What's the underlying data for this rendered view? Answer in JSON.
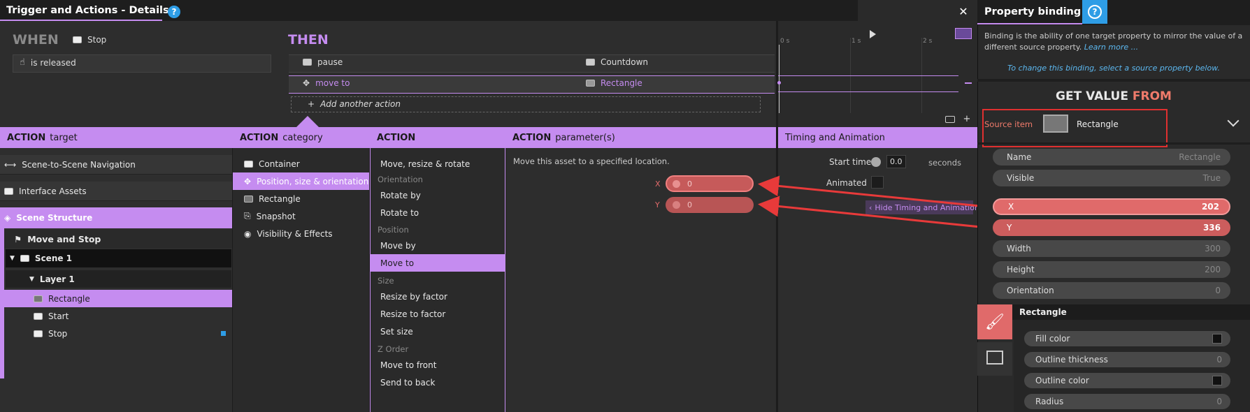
{
  "dialog": {
    "title": "Trigger and Actions - Details",
    "help_glyph": "?",
    "close_glyph": "✕"
  },
  "when": {
    "heading": "WHEN",
    "item": "Stop",
    "event": "is released"
  },
  "then": {
    "heading": "THEN",
    "actions": [
      {
        "name": "pause",
        "target": "Countdown"
      },
      {
        "name": "move to",
        "target": "Rectangle"
      }
    ],
    "add_label": "Add another action"
  },
  "timeline": {
    "ticks": [
      "0 s",
      "1 s",
      "2 s"
    ]
  },
  "headers": {
    "target_bold": "ACTION",
    "target_light": "target",
    "category_bold": "ACTION",
    "category_light": "category",
    "action_bold": "ACTION",
    "params_bold": "ACTION",
    "params_light": "parameter(s)",
    "timing": "Timing and Animation"
  },
  "targets": {
    "nav": "Scene-to-Scene Navigation",
    "assets": "Interface Assets",
    "structure": "Scene Structure",
    "move_stop": "Move and Stop",
    "scene": "Scene 1",
    "layer": "Layer 1",
    "rect": "Rectangle",
    "start": "Start",
    "stop": "Stop"
  },
  "categories": [
    "Container",
    "Position, size & orientation",
    "Rectangle",
    "Snapshot",
    "Visibility & Effects"
  ],
  "actions": {
    "top": "Move, resize & rotate",
    "g_orient": "Orientation",
    "rotate_by": "Rotate by",
    "rotate_to": "Rotate to",
    "g_pos": "Position",
    "move_by": "Move by",
    "move_to": "Move to",
    "g_size": "Size",
    "resize_by": "Resize by factor",
    "resize_to": "Resize to factor",
    "set_size": "Set size",
    "g_z": "Z Order",
    "front": "Move to front",
    "back": "Send to back"
  },
  "params": {
    "description": "Move this asset to a specified location.",
    "x_label": "X",
    "x_value": "0",
    "y_label": "Y",
    "y_value": "0"
  },
  "timing": {
    "start_label": "Start time",
    "start_value": "0.0",
    "unit": "seconds",
    "animated_label": "Animated",
    "hide_button": "Hide Timing and Animation"
  },
  "binding": {
    "title": "Property binding",
    "help_glyph": "?",
    "desc": "Binding is the ability of one target property to mirror the value of a different source property.",
    "learn_more": "Learn more ...",
    "hint": "To change this binding, select a source property below.",
    "get_value": "GET VALUE",
    "from": "FROM",
    "source_label": "Source item",
    "source_value": "Rectangle"
  },
  "props": [
    {
      "name": "Name",
      "value": "Rectangle"
    },
    {
      "name": "Visible",
      "value": "True"
    },
    {
      "name": "X",
      "value": "202"
    },
    {
      "name": "Y",
      "value": "336"
    },
    {
      "name": "Width",
      "value": "300"
    },
    {
      "name": "Height",
      "value": "200"
    },
    {
      "name": "Orientation",
      "value": "0"
    }
  ],
  "rect_section": {
    "title": "Rectangle",
    "props": [
      {
        "name": "Fill color",
        "value": ""
      },
      {
        "name": "Outline thickness",
        "value": "0"
      },
      {
        "name": "Outline color",
        "value": ""
      },
      {
        "name": "Radius",
        "value": "0"
      }
    ]
  },
  "colors": {
    "accent": "#c58cf0",
    "highlight": "#e06a6a",
    "help_blue": "#2e9de6"
  }
}
